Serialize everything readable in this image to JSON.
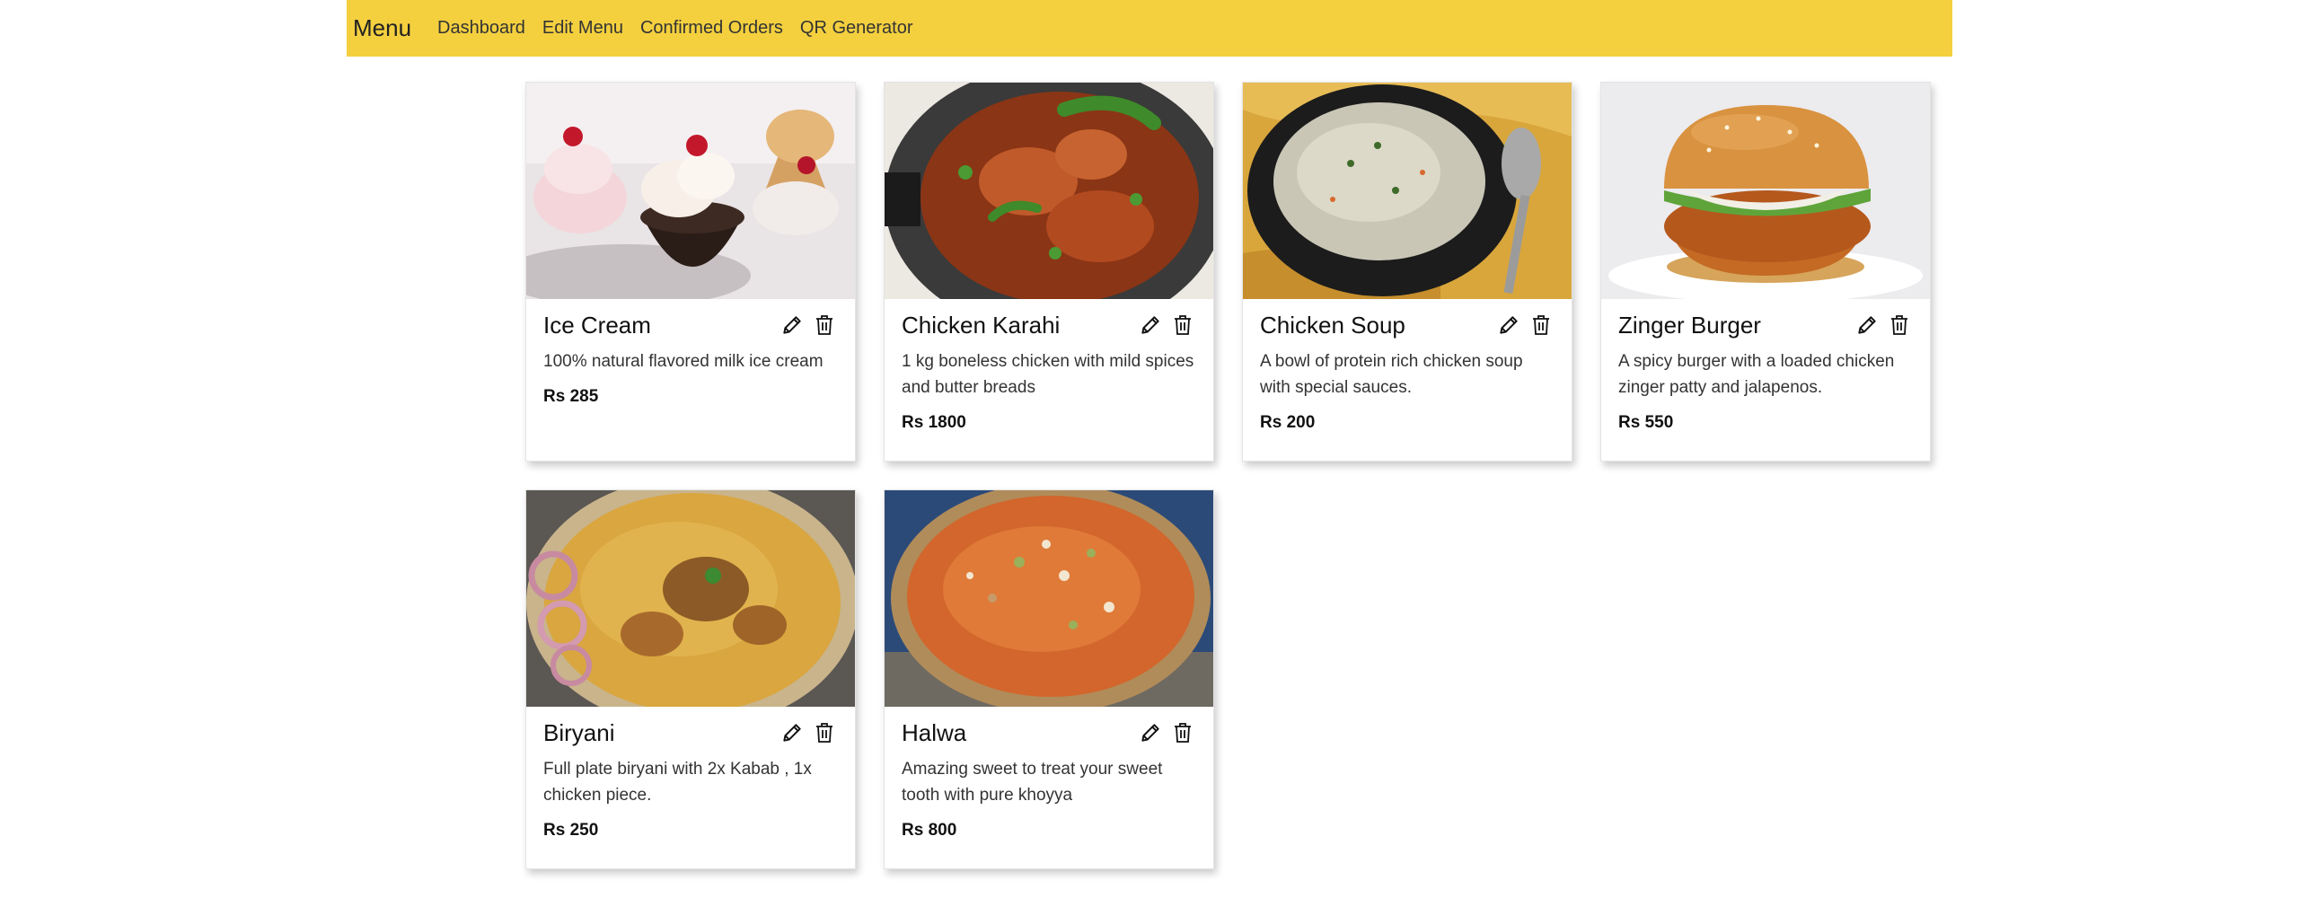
{
  "navbar": {
    "brand": "Menu",
    "links": [
      "Dashboard",
      "Edit Menu",
      "Confirmed Orders",
      "QR Generator"
    ],
    "color": "#f4d03f"
  },
  "items": [
    {
      "name": "Ice Cream",
      "desc": "100% natural flavored milk ice cream",
      "price": "Rs 285"
    },
    {
      "name": "Chicken Karahi",
      "desc": "1 kg boneless chicken with mild spices and butter breads",
      "price": "Rs 1800"
    },
    {
      "name": "Chicken Soup",
      "desc": "A bowl of protein rich chicken soup with special sauces.",
      "price": "Rs 200"
    },
    {
      "name": "Zinger Burger",
      "desc": "A spicy burger with a loaded chicken zinger patty and jalapenos.",
      "price": "Rs 550"
    },
    {
      "name": "Biryani",
      "desc": "Full plate biryani with 2x Kabab , 1x chicken piece.",
      "price": "Rs 250"
    },
    {
      "name": "Halwa",
      "desc": "Amazing sweet to treat your sweet tooth with pure khoyya",
      "price": "Rs 800"
    }
  ],
  "icons": {
    "edit": "pencil-icon",
    "delete": "trash-icon"
  }
}
